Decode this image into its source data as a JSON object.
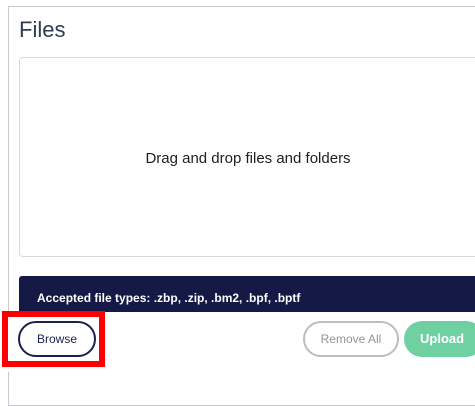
{
  "header": {
    "title": "Files"
  },
  "dropzone": {
    "text": "Drag and drop files and folders"
  },
  "accepted": {
    "text": "Accepted file types: .zbp, .zip, .bm2, .bpf, .bptf"
  },
  "actions": {
    "browse_label": "Browse",
    "remove_all_label": "Remove All",
    "upload_label": "Upload"
  },
  "colors": {
    "types_bar_bg": "#141a45",
    "upload_bg": "#6fd0a2",
    "highlight": "#ff0000"
  }
}
